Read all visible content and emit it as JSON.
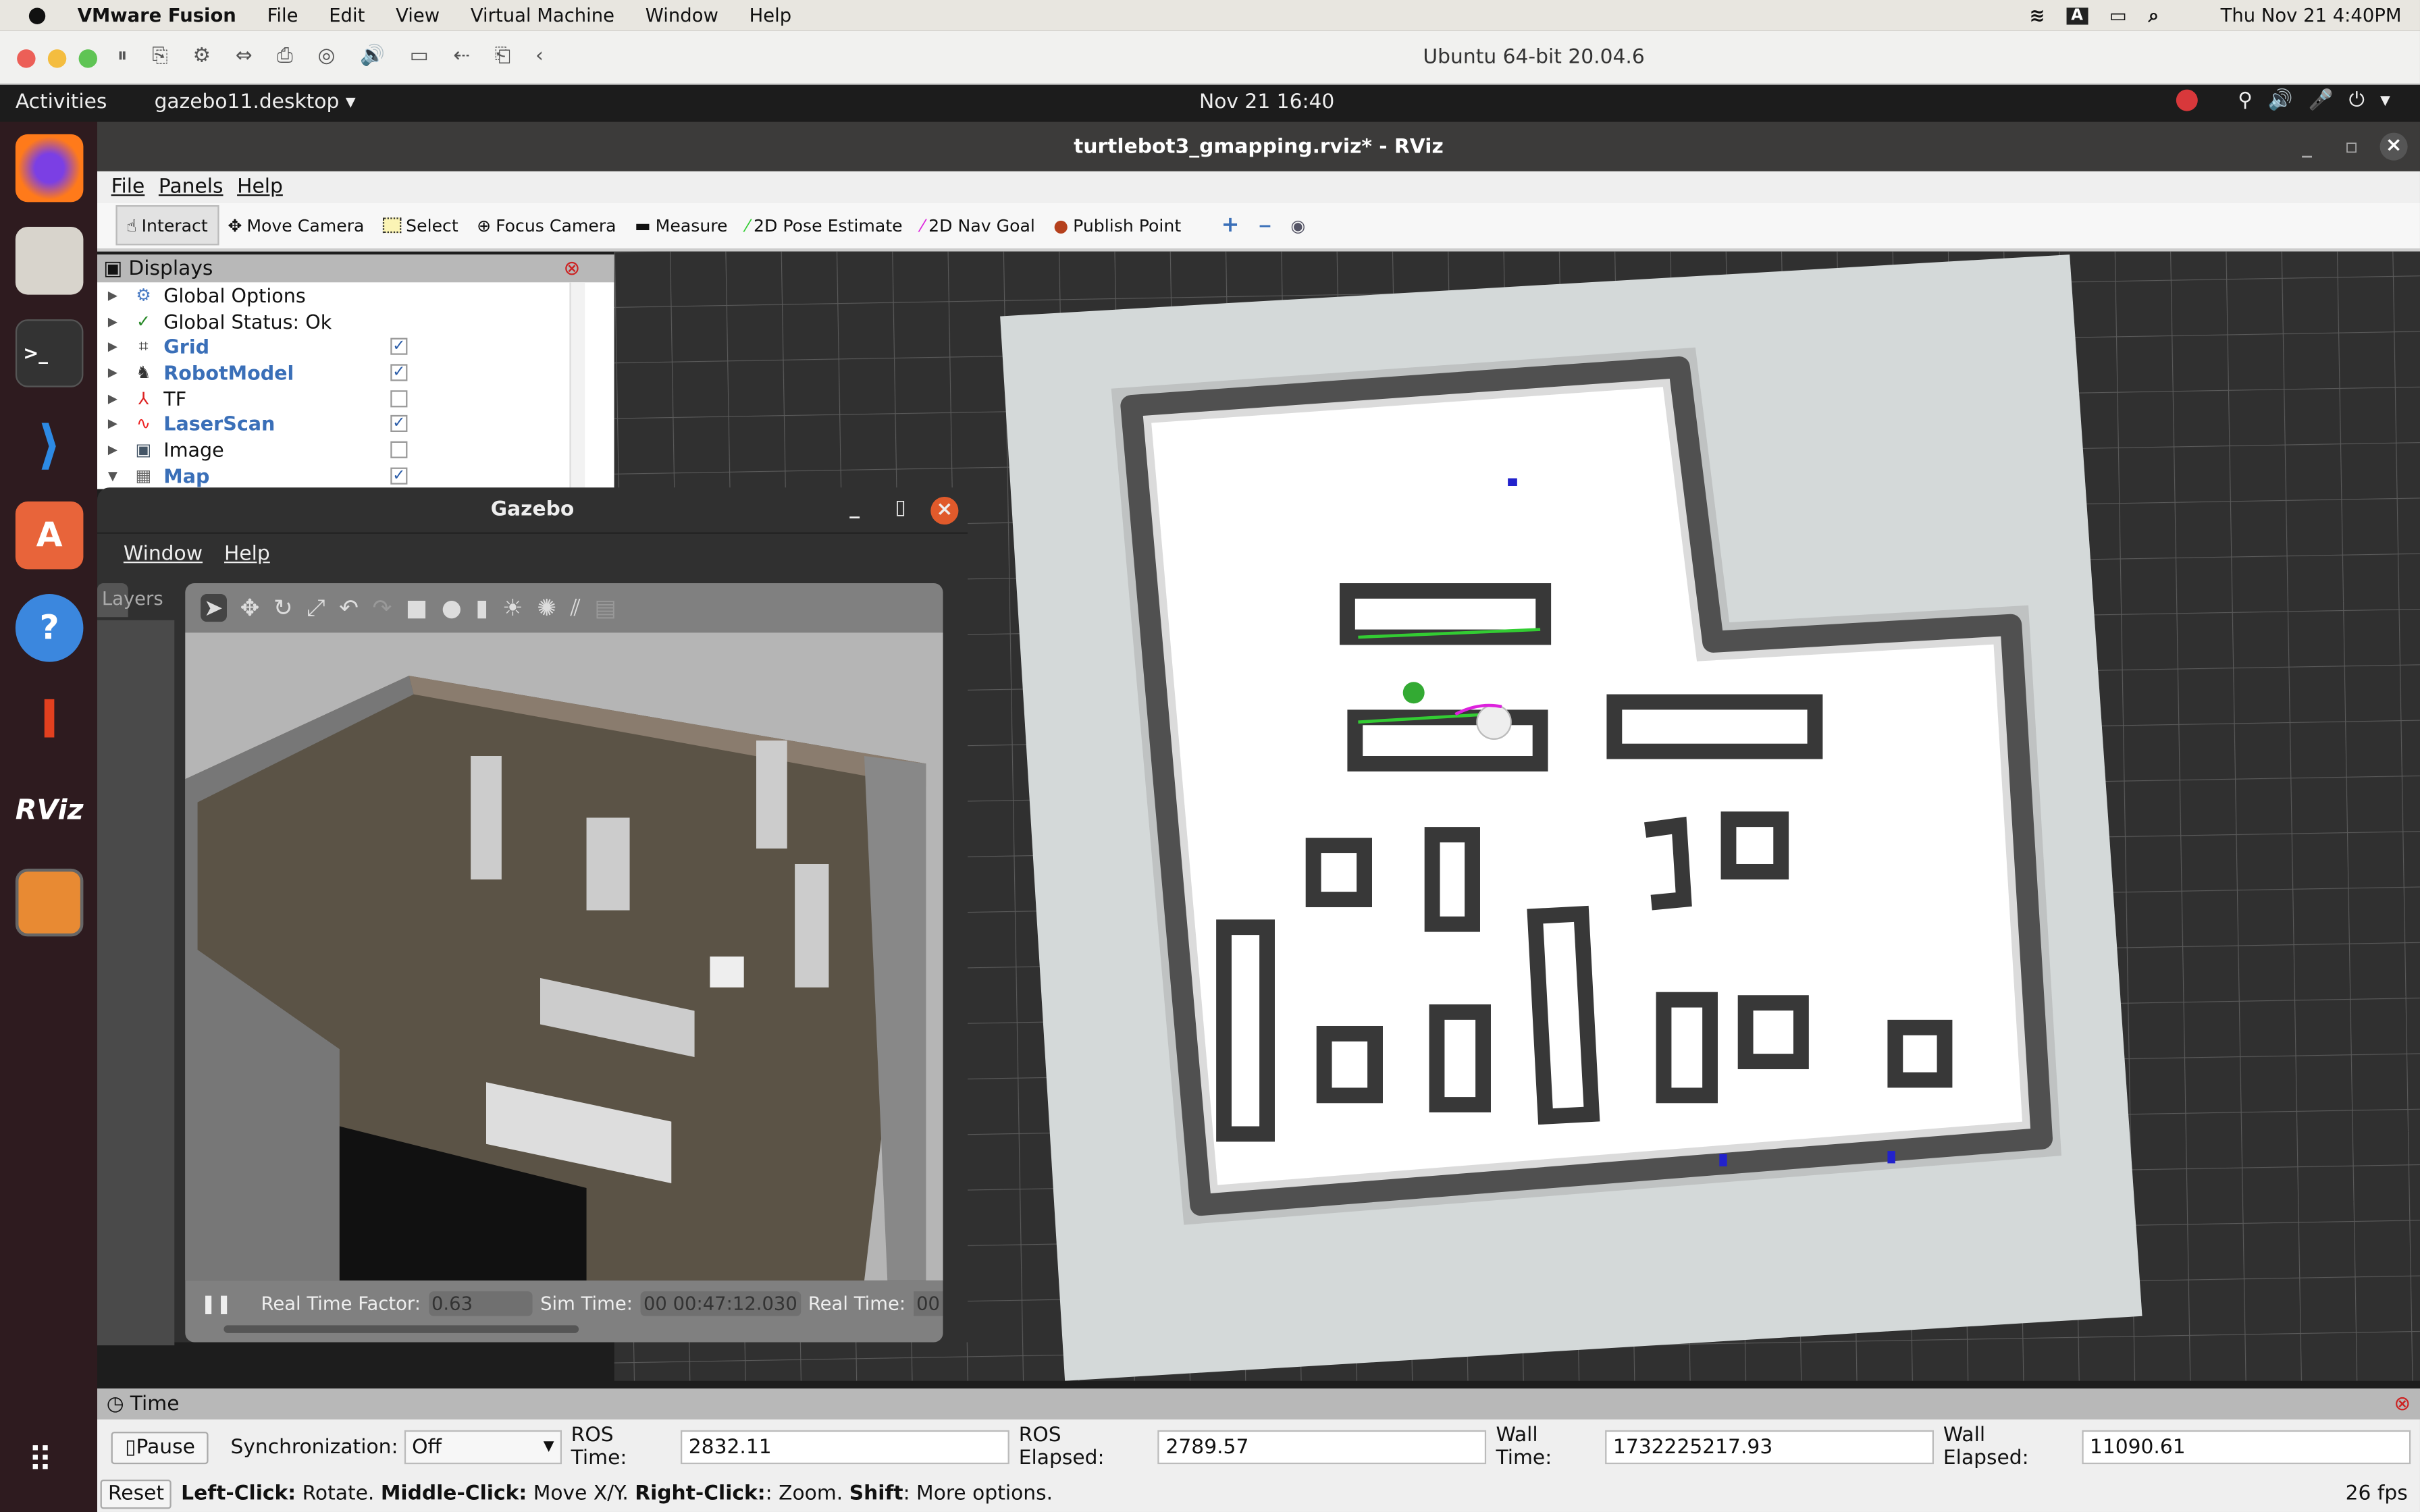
{
  "mac_menubar": {
    "app": "VMware Fusion",
    "items": [
      "File",
      "Edit",
      "View",
      "Virtual Machine",
      "Window",
      "Help"
    ],
    "clock": "Thu Nov 21  4:40PM",
    "input_indicator": "A"
  },
  "vmware": {
    "vm_title": "Ubuntu 64-bit 20.04.6"
  },
  "ubuntu_bar": {
    "activities": "Activities",
    "app_menu": "gazebo11.desktop",
    "clock": "Nov 21  16:40"
  },
  "dock": {
    "items": [
      "firefox",
      "files",
      "terminal",
      "vscode",
      "app-center",
      "help",
      "gmapping-tool",
      "rviz",
      "gazebo"
    ],
    "rviz_label": "RViz"
  },
  "rviz": {
    "title": "turtlebot3_gmapping.rviz* - RViz",
    "menu": [
      "File",
      "Panels",
      "Help"
    ],
    "toolbar": [
      {
        "label": "Interact",
        "icon": "hand-pointer-icon",
        "active": true
      },
      {
        "label": "Move Camera",
        "icon": "move-camera-icon"
      },
      {
        "label": "Select",
        "icon": "select-box-icon"
      },
      {
        "label": "Focus Camera",
        "icon": "focus-camera-icon"
      },
      {
        "label": "Measure",
        "icon": "ruler-icon"
      },
      {
        "label": "2D Pose Estimate",
        "icon": "green-arrow-icon"
      },
      {
        "label": "2D Nav Goal",
        "icon": "magenta-arrow-icon"
      },
      {
        "label": "Publish Point",
        "icon": "map-pin-icon"
      }
    ],
    "displays": {
      "title": "Displays",
      "items": [
        {
          "label": "Global Options",
          "icon": "gear-icon",
          "enabled": null,
          "expanded": false
        },
        {
          "label": "Global Status: Ok",
          "icon": "check-icon",
          "enabled": null,
          "expanded": false
        },
        {
          "label": "Grid",
          "icon": "grid-icon",
          "enabled": true,
          "expanded": false
        },
        {
          "label": "RobotModel",
          "icon": "robot-icon",
          "enabled": true,
          "expanded": false
        },
        {
          "label": "TF",
          "icon": "axes-icon",
          "enabled": false,
          "expanded": false
        },
        {
          "label": "LaserScan",
          "icon": "laser-icon",
          "enabled": true,
          "expanded": false
        },
        {
          "label": "Image",
          "icon": "image-icon",
          "enabled": false,
          "expanded": false
        },
        {
          "label": "Map",
          "icon": "map-icon",
          "enabled": true,
          "expanded": true
        }
      ]
    },
    "time_panel": {
      "title": "Time",
      "pause_label": "Pause",
      "sync_label": "Synchronization:",
      "sync_value": "Off",
      "ros_time_label": "ROS Time:",
      "ros_time": "2832.11",
      "ros_elapsed_label": "ROS Elapsed:",
      "ros_elapsed": "2789.57",
      "wall_time_label": "Wall Time:",
      "wall_time": "1732225217.93",
      "wall_elapsed_label": "Wall Elapsed:",
      "wall_elapsed": "11090.61"
    },
    "status": {
      "reset": "Reset",
      "b1": "Left-Click:",
      "t1": " Rotate. ",
      "b2": "Middle-Click:",
      "t2": " Move X/Y. ",
      "b3": "Right-Click:",
      "t3": ": Zoom. ",
      "b4": "Shift",
      "t4": ": More options.",
      "fps": "26 fps"
    }
  },
  "gazebo": {
    "title": "Gazebo",
    "menu": [
      "Window",
      "Help"
    ],
    "left_tab": "Layers",
    "rtf_label": "Real Time Factor:",
    "rtf": "0.63",
    "sim_time_label": "Sim Time:",
    "sim_time": "00 00:47:12.030",
    "real_time_label": "Real Time:",
    "real_time": "00"
  },
  "colors": {
    "rviz_bg": "#303030",
    "map_free": "#ffffff",
    "map_unknown": "#d3d8d8",
    "map_wall": "#111111",
    "selected_blue": "#3a6fb8"
  }
}
